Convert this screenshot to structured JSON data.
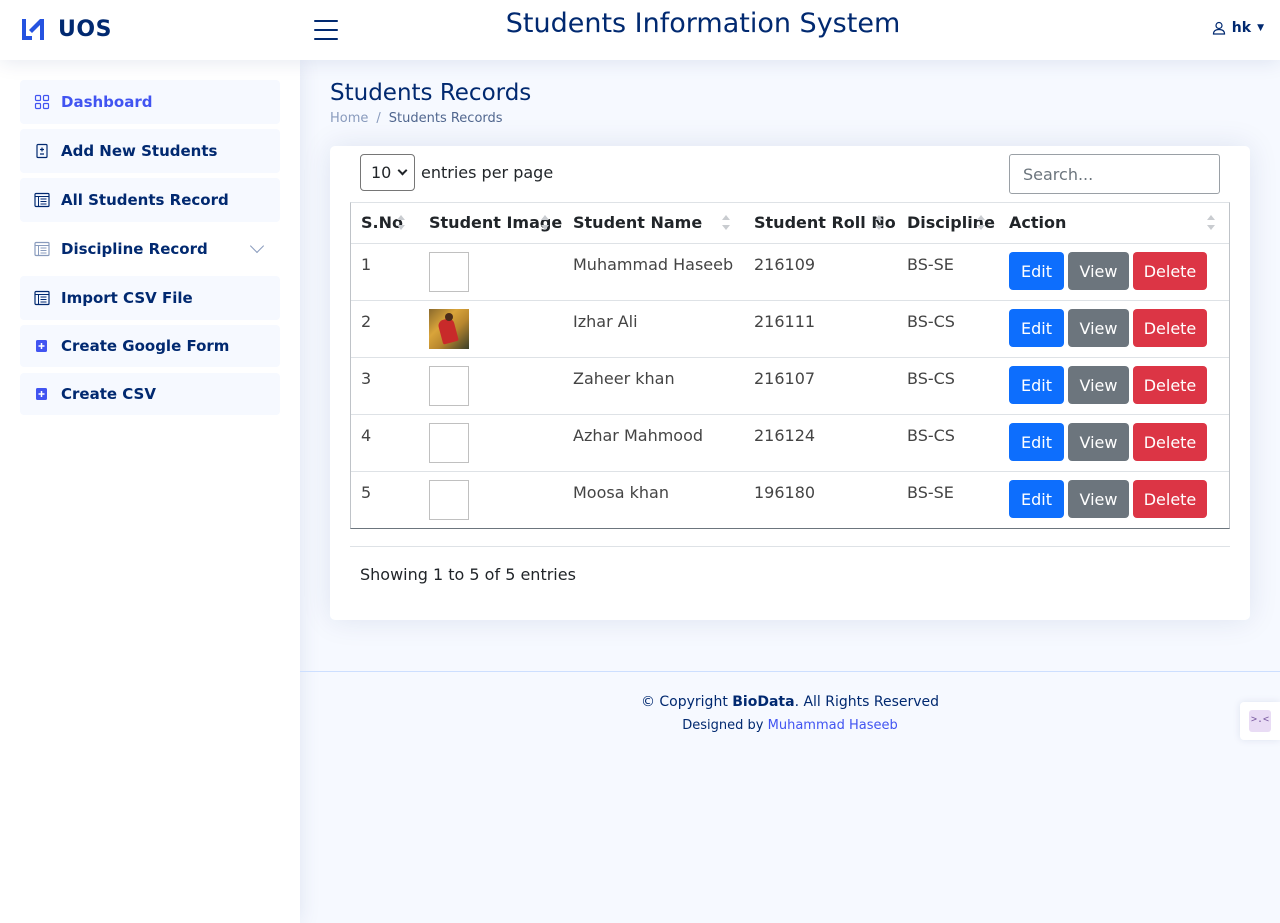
{
  "header": {
    "logo_text": "UOS",
    "app_title": "Students Information System",
    "user_name": "hk"
  },
  "sidebar": {
    "items": [
      {
        "label": "Dashboard",
        "icon": "grid-icon"
      },
      {
        "label": "Add New Students",
        "icon": "file-plus-minus-icon"
      },
      {
        "label": "All Students Record",
        "icon": "layout-text-window-icon"
      },
      {
        "label": "Discipline Record",
        "icon": "layout-text-window-icon"
      },
      {
        "label": "Import CSV File",
        "icon": "layout-text-window-icon"
      },
      {
        "label": "Create Google Form",
        "icon": "plus-square-icon"
      },
      {
        "label": "Create CSV",
        "icon": "plus-square-icon"
      }
    ]
  },
  "page": {
    "title": "Students Records",
    "breadcrumb": [
      "Home",
      "Students Records"
    ]
  },
  "table_controls": {
    "per_page_value": "10",
    "per_page_label": "entries per page",
    "search_placeholder": "Search..."
  },
  "table": {
    "columns": [
      "S.No",
      "Student Image",
      "Student Name",
      "Student Roll No",
      "Discipline",
      "Action"
    ],
    "rows": [
      {
        "sno": "1",
        "name": "Muhammad Haseeb",
        "roll": "216109",
        "discipline": "BS-SE"
      },
      {
        "sno": "2",
        "name": "Izhar Ali",
        "roll": "216111",
        "discipline": "BS-CS"
      },
      {
        "sno": "3",
        "name": "Zaheer khan",
        "roll": "216107",
        "discipline": "BS-CS"
      },
      {
        "sno": "4",
        "name": "Azhar Mahmood",
        "roll": "216124",
        "discipline": "BS-CS"
      },
      {
        "sno": "5",
        "name": "Moosa khan",
        "roll": "196180",
        "discipline": "BS-SE"
      }
    ],
    "actions": {
      "edit": "Edit",
      "view": "View",
      "delete": "Delete"
    }
  },
  "table_info": "Showing 1 to 5 of 5 entries",
  "footer": {
    "copyright_prefix": "© Copyright ",
    "brand": "BioData",
    "copyright_suffix": ". All Rights Reserved",
    "designed_by": "Designed by ",
    "author": "Muhammad Haseeb"
  },
  "colors": {
    "primary": "#012970",
    "accent": "#4154f1",
    "edit": "#0d6efd",
    "view": "#6c757d",
    "delete": "#dc3545"
  }
}
